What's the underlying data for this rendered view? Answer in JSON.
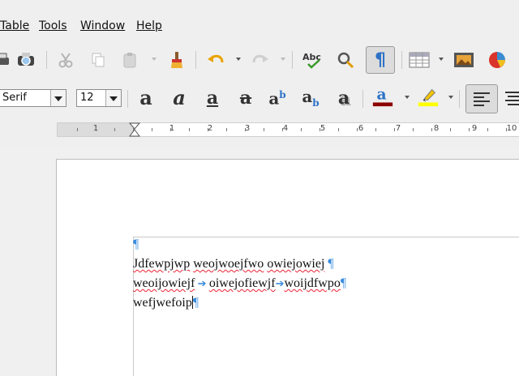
{
  "menubar": {
    "items": [
      {
        "id": "table",
        "label": "Table"
      },
      {
        "id": "tools",
        "label": "Tools"
      },
      {
        "id": "window",
        "label": "Window"
      },
      {
        "id": "help",
        "label": "Help"
      }
    ]
  },
  "formatting": {
    "font_name": "Serif",
    "font_size": "12"
  },
  "ruler": {
    "labels": [
      "1",
      "1",
      "2",
      "3",
      "4",
      "5",
      "6",
      "7",
      "8",
      "9",
      "10"
    ]
  },
  "document": {
    "lines": [
      {
        "segments": [
          {
            "t": "¶",
            "k": "pilcrow"
          }
        ]
      },
      {
        "segments": [
          {
            "t": "Jdfewpjwp",
            "k": "sq"
          },
          {
            "t": " ",
            "k": "txt"
          },
          {
            "t": "weojwoejfwo",
            "k": "sq"
          },
          {
            "t": " ",
            "k": "txt"
          },
          {
            "t": "owiejowiej",
            "k": "sq"
          },
          {
            "t": " ",
            "k": "txt"
          },
          {
            "t": "¶",
            "k": "pilcrow"
          }
        ]
      },
      {
        "segments": [
          {
            "t": "weoijowiejf",
            "k": "sq"
          },
          {
            "t": " ➔ ",
            "k": "tab"
          },
          {
            "t": "oiwejofiewjf",
            "k": "sq"
          },
          {
            "t": "➔",
            "k": "tab"
          },
          {
            "t": "woijdfwpo",
            "k": "sq"
          },
          {
            "t": "¶",
            "k": "pilcrow"
          }
        ]
      },
      {
        "segments": [
          {
            "t": "wefjwefoip",
            "k": "txt"
          },
          {
            "t": "",
            "k": "caret"
          },
          {
            "t": "¶",
            "k": "pilcrow"
          }
        ]
      }
    ]
  },
  "colors": {
    "font_color": "#8b0000",
    "highlight_color": "#ffff00",
    "pilcrow": "#3c8dde",
    "spell_underline": "#e23333"
  }
}
